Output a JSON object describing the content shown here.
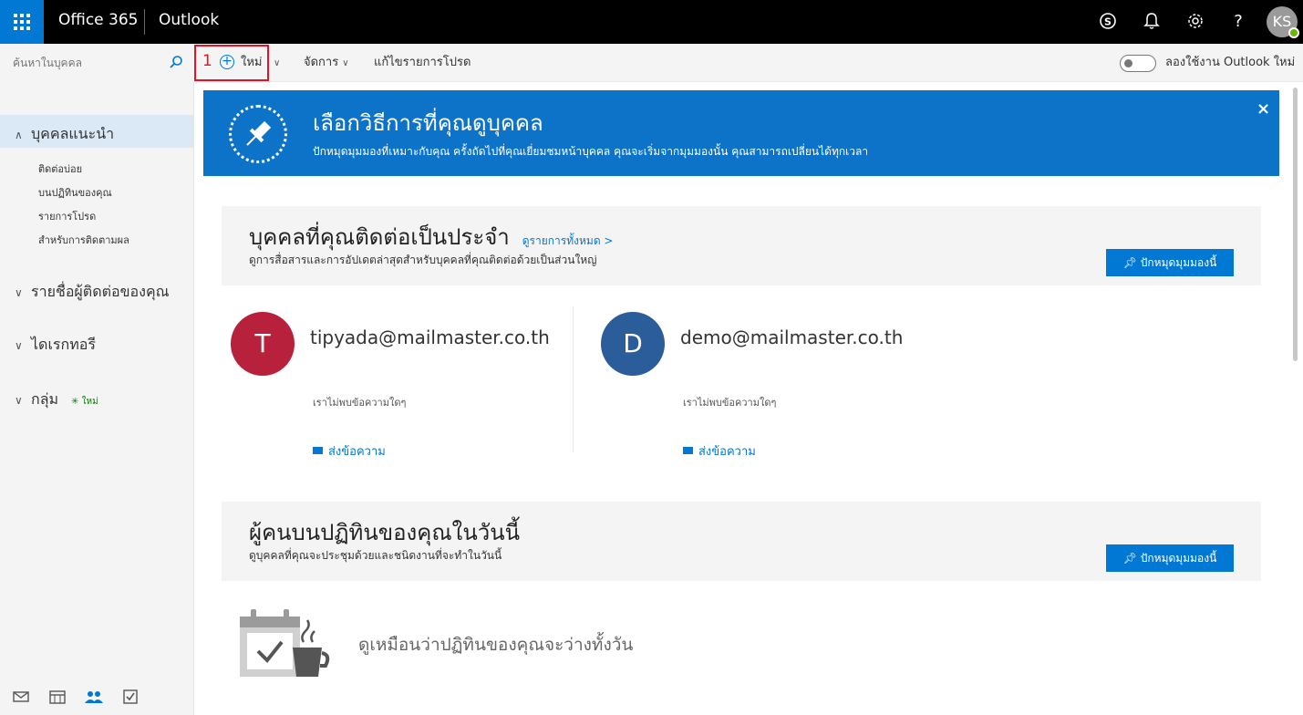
{
  "topbar": {
    "brand": "Office 365",
    "app_name": "Outlook",
    "avatar_initials": "KS",
    "icons": [
      "waffle-icon",
      "skype-icon",
      "bell-icon",
      "gear-icon",
      "help-icon"
    ],
    "help_glyph": "?"
  },
  "search": {
    "placeholder": "ค้นหาในบุคคล"
  },
  "toolbar": {
    "step_number": "1",
    "new_label": "ใหม่",
    "manage_label": "จัดการ",
    "edit_favorites_label": "แก้ไขรายการโปรด",
    "try_outlook_label": "ลองใช้งาน Outlook ใหม่"
  },
  "sidebar": {
    "sections": [
      {
        "label": "บุคคลแนะนำ",
        "expanded": true,
        "items": [
          "ติดต่อบ่อย",
          "บนปฏิทินของคุณ",
          "รายการโปรด",
          "สำหรับการติดตามผล"
        ]
      },
      {
        "label": "รายชื่อผู้ติดต่อของคุณ",
        "expanded": false
      },
      {
        "label": "ไดเรกทอรี",
        "expanded": false
      },
      {
        "label": "กลุ่ม",
        "expanded": false,
        "badge": "ใหม่"
      }
    ],
    "bottom_icons": [
      "mail-icon",
      "calendar-icon",
      "people-icon",
      "tasks-icon"
    ]
  },
  "banner": {
    "title": "เลือกวิธีการที่คุณดูบุคคล",
    "subtitle": "ปักหมุดมุมมองที่เหมาะกับคุณ ครั้งถัดไปที่คุณเยี่ยมชมหน้าบุคคล คุณจะเริ่มจากมุมมองนั้น คุณสามารถเปลี่ยนได้ทุกเวลา",
    "close": "×"
  },
  "frequent": {
    "title": "บุคคลที่คุณติดต่อเป็นประจำ",
    "see_all": "ดูรายการทั้งหมด >",
    "subtitle": "ดูการสื่อสารและการอัปเดตล่าสุดสำหรับบุคคลที่คุณติดต่อด้วยเป็นส่วนใหญ่",
    "pin_label": "ปักหมุดมุมมองนี้",
    "contacts": [
      {
        "initial": "T",
        "email": "tipyada@mailmaster.co.th",
        "status": "เราไม่พบข้อความใดๆ",
        "send": "ส่งข้อความ",
        "color": "#b8213b"
      },
      {
        "initial": "D",
        "email": "demo@mailmaster.co.th",
        "status": "เราไม่พบข้อความใดๆ",
        "send": "ส่งข้อความ",
        "color": "#2b5d9a"
      }
    ]
  },
  "calendar_section": {
    "title": "ผู้คนบนปฏิทินของคุณในวันนี้",
    "subtitle": "ดูบุคคลที่คุณจะประชุมด้วยและชนิดงานที่จะทำในวันนี้",
    "pin_label": "ปักหมุดมุมมองนี้",
    "empty_text": "ดูเหมือนว่าปฏิทินของคุณจะว่างทั้งวัน"
  },
  "colors": {
    "accent": "#0078d4",
    "banner": "#0c73c9",
    "highlight": "#e81123"
  }
}
